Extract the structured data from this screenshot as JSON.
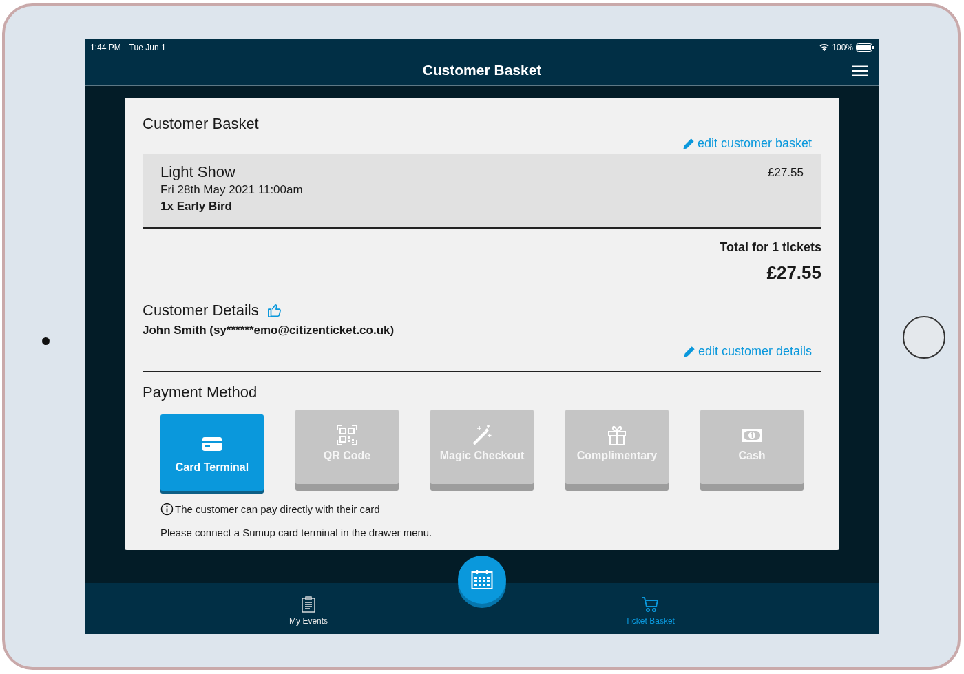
{
  "status_bar": {
    "time": "1:44 PM",
    "date": "Tue Jun 1",
    "battery": "100%"
  },
  "header": {
    "title": "Customer Basket"
  },
  "basket": {
    "title": "Customer Basket",
    "edit_link": "edit customer basket",
    "items": [
      {
        "name": "Light Show",
        "date": "Fri 28th May 2021 11:00am",
        "tickets": "1x Early Bird",
        "price": "£27.55"
      }
    ],
    "total_label": "Total for 1 tickets",
    "total": "£27.55"
  },
  "customer": {
    "title": "Customer Details",
    "details": "John Smith (sy******emo@citizenticket.co.uk)",
    "edit_link": "edit customer details"
  },
  "payment": {
    "title": "Payment Method",
    "methods": [
      {
        "label": "Card Terminal",
        "kind": "card",
        "selected": true
      },
      {
        "label": "QR Code",
        "kind": "qr",
        "selected": false
      },
      {
        "label": "Magic Checkout",
        "kind": "wand",
        "selected": false
      },
      {
        "label": "Complimentary",
        "kind": "gift",
        "selected": false
      },
      {
        "label": "Cash",
        "kind": "cash",
        "selected": false
      }
    ],
    "info": "The customer can pay directly with their card",
    "note": "Please connect a Sumup card terminal in the drawer menu."
  },
  "bottom_nav": {
    "items": [
      {
        "label": "My Events",
        "kind": "events",
        "selected": false
      },
      {
        "label": "Ticket Basket",
        "kind": "basket",
        "selected": true
      }
    ]
  }
}
